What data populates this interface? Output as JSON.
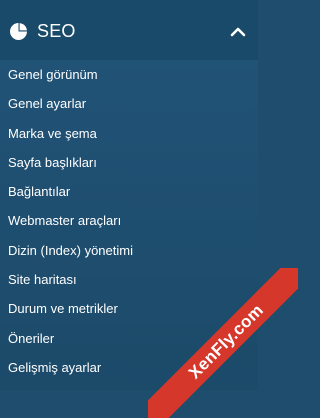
{
  "section": {
    "title": "SEO",
    "icon": "pie-chart-icon",
    "toggle_icon": "chevron-up-icon"
  },
  "menu": {
    "items": [
      {
        "label": "Genel görünüm"
      },
      {
        "label": "Genel ayarlar"
      },
      {
        "label": "Marka ve şema"
      },
      {
        "label": "Sayfa başlıkları"
      },
      {
        "label": "Bağlantılar"
      },
      {
        "label": "Webmaster araçları"
      },
      {
        "label": "Dizin (Index) yönetimi"
      },
      {
        "label": "Site haritası"
      },
      {
        "label": "Durum ve metrikler"
      },
      {
        "label": "Öneriler"
      },
      {
        "label": "Gelişmiş ayarlar"
      }
    ]
  },
  "watermark": {
    "text": "XenFly.com",
    "color": "#d5372b"
  },
  "colors": {
    "sidebar_background": "#1f4f71",
    "header_background": "#1a4a6a",
    "text": "#ffffff"
  }
}
